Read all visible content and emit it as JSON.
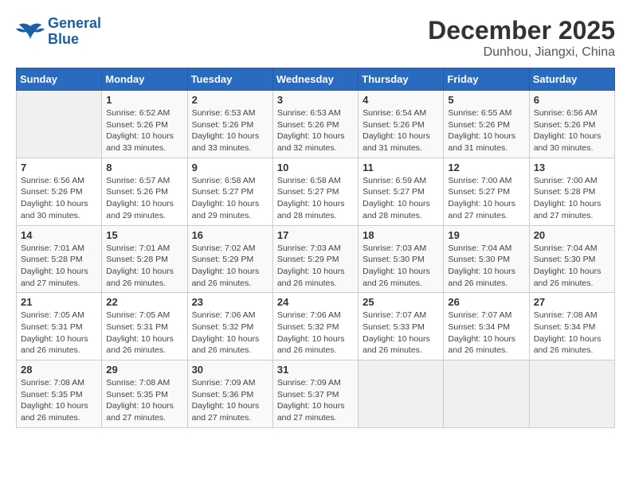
{
  "header": {
    "logo_line1": "General",
    "logo_line2": "Blue",
    "month": "December 2025",
    "location": "Dunhou, Jiangxi, China"
  },
  "weekdays": [
    "Sunday",
    "Monday",
    "Tuesday",
    "Wednesday",
    "Thursday",
    "Friday",
    "Saturday"
  ],
  "weeks": [
    [
      {
        "day": "",
        "info": ""
      },
      {
        "day": "1",
        "info": "Sunrise: 6:52 AM\nSunset: 5:26 PM\nDaylight: 10 hours\nand 33 minutes."
      },
      {
        "day": "2",
        "info": "Sunrise: 6:53 AM\nSunset: 5:26 PM\nDaylight: 10 hours\nand 33 minutes."
      },
      {
        "day": "3",
        "info": "Sunrise: 6:53 AM\nSunset: 5:26 PM\nDaylight: 10 hours\nand 32 minutes."
      },
      {
        "day": "4",
        "info": "Sunrise: 6:54 AM\nSunset: 5:26 PM\nDaylight: 10 hours\nand 31 minutes."
      },
      {
        "day": "5",
        "info": "Sunrise: 6:55 AM\nSunset: 5:26 PM\nDaylight: 10 hours\nand 31 minutes."
      },
      {
        "day": "6",
        "info": "Sunrise: 6:56 AM\nSunset: 5:26 PM\nDaylight: 10 hours\nand 30 minutes."
      }
    ],
    [
      {
        "day": "7",
        "info": "Sunrise: 6:56 AM\nSunset: 5:26 PM\nDaylight: 10 hours\nand 30 minutes."
      },
      {
        "day": "8",
        "info": "Sunrise: 6:57 AM\nSunset: 5:26 PM\nDaylight: 10 hours\nand 29 minutes."
      },
      {
        "day": "9",
        "info": "Sunrise: 6:58 AM\nSunset: 5:27 PM\nDaylight: 10 hours\nand 29 minutes."
      },
      {
        "day": "10",
        "info": "Sunrise: 6:58 AM\nSunset: 5:27 PM\nDaylight: 10 hours\nand 28 minutes."
      },
      {
        "day": "11",
        "info": "Sunrise: 6:59 AM\nSunset: 5:27 PM\nDaylight: 10 hours\nand 28 minutes."
      },
      {
        "day": "12",
        "info": "Sunrise: 7:00 AM\nSunset: 5:27 PM\nDaylight: 10 hours\nand 27 minutes."
      },
      {
        "day": "13",
        "info": "Sunrise: 7:00 AM\nSunset: 5:28 PM\nDaylight: 10 hours\nand 27 minutes."
      }
    ],
    [
      {
        "day": "14",
        "info": "Sunrise: 7:01 AM\nSunset: 5:28 PM\nDaylight: 10 hours\nand 27 minutes."
      },
      {
        "day": "15",
        "info": "Sunrise: 7:01 AM\nSunset: 5:28 PM\nDaylight: 10 hours\nand 26 minutes."
      },
      {
        "day": "16",
        "info": "Sunrise: 7:02 AM\nSunset: 5:29 PM\nDaylight: 10 hours\nand 26 minutes."
      },
      {
        "day": "17",
        "info": "Sunrise: 7:03 AM\nSunset: 5:29 PM\nDaylight: 10 hours\nand 26 minutes."
      },
      {
        "day": "18",
        "info": "Sunrise: 7:03 AM\nSunset: 5:30 PM\nDaylight: 10 hours\nand 26 minutes."
      },
      {
        "day": "19",
        "info": "Sunrise: 7:04 AM\nSunset: 5:30 PM\nDaylight: 10 hours\nand 26 minutes."
      },
      {
        "day": "20",
        "info": "Sunrise: 7:04 AM\nSunset: 5:30 PM\nDaylight: 10 hours\nand 26 minutes."
      }
    ],
    [
      {
        "day": "21",
        "info": "Sunrise: 7:05 AM\nSunset: 5:31 PM\nDaylight: 10 hours\nand 26 minutes."
      },
      {
        "day": "22",
        "info": "Sunrise: 7:05 AM\nSunset: 5:31 PM\nDaylight: 10 hours\nand 26 minutes."
      },
      {
        "day": "23",
        "info": "Sunrise: 7:06 AM\nSunset: 5:32 PM\nDaylight: 10 hours\nand 26 minutes."
      },
      {
        "day": "24",
        "info": "Sunrise: 7:06 AM\nSunset: 5:32 PM\nDaylight: 10 hours\nand 26 minutes."
      },
      {
        "day": "25",
        "info": "Sunrise: 7:07 AM\nSunset: 5:33 PM\nDaylight: 10 hours\nand 26 minutes."
      },
      {
        "day": "26",
        "info": "Sunrise: 7:07 AM\nSunset: 5:34 PM\nDaylight: 10 hours\nand 26 minutes."
      },
      {
        "day": "27",
        "info": "Sunrise: 7:08 AM\nSunset: 5:34 PM\nDaylight: 10 hours\nand 26 minutes."
      }
    ],
    [
      {
        "day": "28",
        "info": "Sunrise: 7:08 AM\nSunset: 5:35 PM\nDaylight: 10 hours\nand 26 minutes."
      },
      {
        "day": "29",
        "info": "Sunrise: 7:08 AM\nSunset: 5:35 PM\nDaylight: 10 hours\nand 27 minutes."
      },
      {
        "day": "30",
        "info": "Sunrise: 7:09 AM\nSunset: 5:36 PM\nDaylight: 10 hours\nand 27 minutes."
      },
      {
        "day": "31",
        "info": "Sunrise: 7:09 AM\nSunset: 5:37 PM\nDaylight: 10 hours\nand 27 minutes."
      },
      {
        "day": "",
        "info": ""
      },
      {
        "day": "",
        "info": ""
      },
      {
        "day": "",
        "info": ""
      }
    ]
  ]
}
